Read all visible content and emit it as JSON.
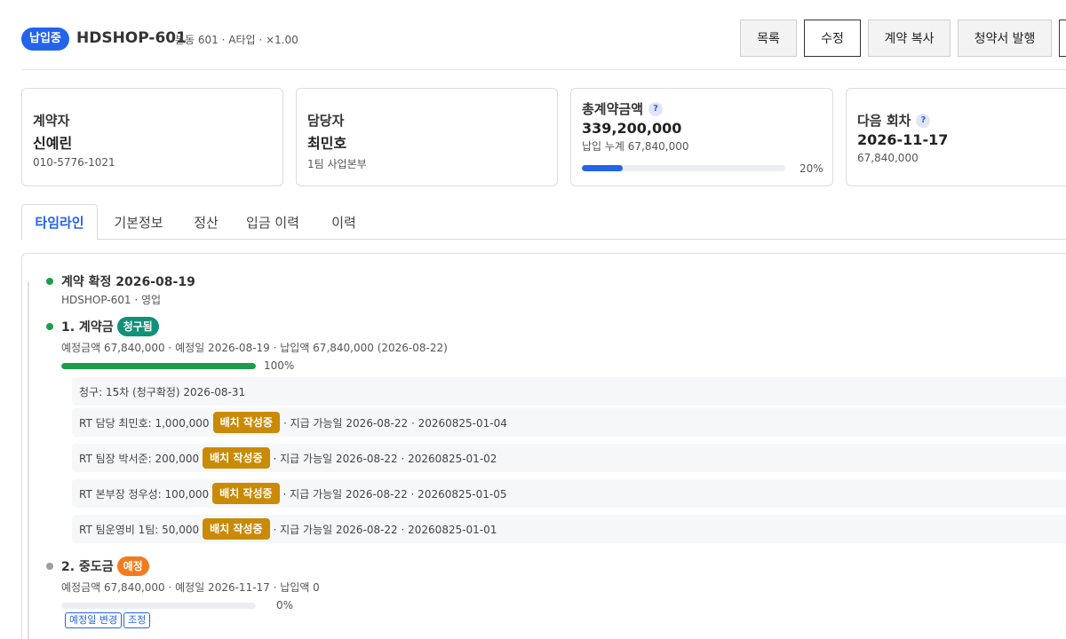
{
  "header": {
    "status": "납입중",
    "code": "HDSHOP-601",
    "meta": "본동 601 · A타입 · ×1.00",
    "buttons": [
      "목록",
      "수정",
      "계약 복사",
      "청약서 발행"
    ]
  },
  "cards": {
    "contractor": {
      "title": "계약자",
      "name": "신예린",
      "phone": "010-5776-1021"
    },
    "manager": {
      "title": "담당자",
      "name": "최민호",
      "team": "1팀 사업본부"
    },
    "total": {
      "title": "총계약금액",
      "amount": "339,200,000",
      "paid": "납입 누계 67,840,000",
      "progress": 20,
      "progress_label": "20%"
    },
    "next": {
      "title": "다음 회차",
      "date": "2026-11-17",
      "amount": "67,840,000"
    }
  },
  "tabs": [
    "타임라인",
    "기본정보",
    "정산",
    "입금 이력",
    "이력"
  ],
  "timeline": {
    "confirm": {
      "title": "계약 확정 2026-08-19",
      "sub": "HDSHOP-601 · 영업"
    },
    "installment1": {
      "title": "1. 계약금",
      "badge": "청구됨",
      "sub": "예정금액 67,840,000 · 예정일 2026-08-19 · 납입액 67,840,000 (2026-08-22)",
      "progress": 100,
      "progress_label": "100%",
      "claim": "청구: 15차 (청구확정) 2026-08-31",
      "rows": [
        {
          "label": "RT 담당 최민호: 1,000,000",
          "badge": "배치 작성중",
          "tail": "· 지급 가능일 2026-08-22 · 20260825-01-04"
        },
        {
          "label": "RT 팀장 박서준: 200,000",
          "badge": "배치 작성중",
          "tail": "· 지급 가능일 2026-08-22 · 20260825-01-02"
        },
        {
          "label": "RT 본부장 정우성: 100,000",
          "badge": "배치 작성중",
          "tail": "· 지급 가능일 2026-08-22 · 20260825-01-05"
        },
        {
          "label": "RT 팀운영비 1팀: 50,000",
          "badge": "배치 작성중",
          "tail": "· 지급 가능일 2026-08-22 · 20260825-01-01"
        }
      ]
    },
    "installment2": {
      "title": "2. 중도금",
      "badge": "예정",
      "sub": "예정금액 67,840,000 · 예정일 2026-11-17 · 납입액 0",
      "progress": 0,
      "progress_label": "0%",
      "actions": [
        "예정일 변경",
        "조정"
      ]
    }
  },
  "colors": {
    "primary": "#2463eb",
    "green": "#1a9e4a",
    "teal": "#119178",
    "amber": "#c98a06",
    "orange": "#f27b1f",
    "gray_dot": "#9aa0a6"
  }
}
